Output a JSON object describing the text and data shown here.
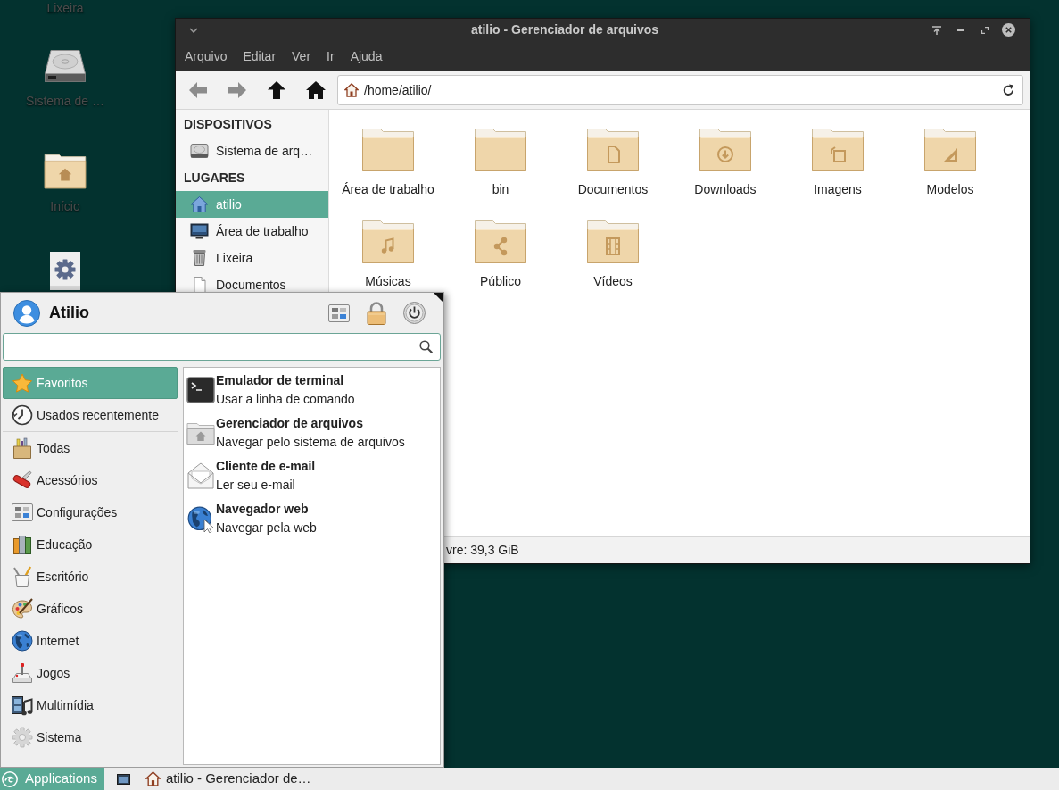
{
  "desktop": {
    "icons": [
      {
        "kind": "label",
        "label": "Lixeira"
      },
      {
        "kind": "drive",
        "label": "Sistema de …"
      },
      {
        "kind": "home",
        "label": "Início"
      },
      {
        "kind": "settings"
      }
    ]
  },
  "file_manager": {
    "title": "atilio - Gerenciador de arquivos",
    "menu": [
      "Arquivo",
      "Editar",
      "Ver",
      "Ir",
      "Ajuda"
    ],
    "toolbar": [
      {
        "kind": "back",
        "disabled": true
      },
      {
        "kind": "forward",
        "disabled": true
      },
      {
        "kind": "up",
        "disabled": false
      },
      {
        "kind": "home",
        "disabled": false
      }
    ],
    "address": "/home/atilio/",
    "sidebar": [
      {
        "heading": "DISPOSITIVOS",
        "items": [
          {
            "kind": "drive",
            "label": "Sistema de arq…",
            "selected": false
          }
        ]
      },
      {
        "heading": "LUGARES",
        "items": [
          {
            "kind": "home",
            "label": "atilio",
            "selected": true
          },
          {
            "kind": "desktop",
            "label": "Área de trabalho",
            "selected": false
          },
          {
            "kind": "trash",
            "label": "Lixeira",
            "selected": false
          },
          {
            "kind": "document",
            "label": "Documentos",
            "selected": false
          }
        ]
      }
    ],
    "files": [
      {
        "kind": "plain",
        "name": "Área de trabalho"
      },
      {
        "kind": "plain",
        "name": "bin"
      },
      {
        "kind": "document",
        "name": "Documentos"
      },
      {
        "kind": "download",
        "name": "Downloads"
      },
      {
        "kind": "image",
        "name": "Imagens"
      },
      {
        "kind": "template",
        "name": "Modelos"
      },
      {
        "kind": "music",
        "name": "Músicas"
      },
      {
        "kind": "share",
        "name": "Público"
      },
      {
        "kind": "video",
        "name": "Vídeos"
      }
    ],
    "status_bar": "vre: 39,3 GiB"
  },
  "menu": {
    "user": "Atilio",
    "category_groups": [
      {
        "items": [
          {
            "kind": "favorites",
            "label": "Favoritos",
            "selected": true
          },
          {
            "kind": "recent",
            "label": "Usados recentemente",
            "selected": false
          }
        ]
      },
      {
        "items": [
          {
            "kind": "all",
            "label": "Todas",
            "selected": false
          },
          {
            "kind": "accessories",
            "label": "Acessórios",
            "selected": false
          },
          {
            "kind": "settings",
            "label": "Configurações",
            "selected": false
          },
          {
            "kind": "education",
            "label": "Educação",
            "selected": false
          },
          {
            "kind": "office",
            "label": "Escritório",
            "selected": false
          },
          {
            "kind": "graphics",
            "label": "Gráficos",
            "selected": false
          },
          {
            "kind": "internet",
            "label": "Internet",
            "selected": false
          },
          {
            "kind": "games",
            "label": "Jogos",
            "selected": false
          },
          {
            "kind": "multimedia",
            "label": "Multimídia",
            "selected": false
          },
          {
            "kind": "system",
            "label": "Sistema",
            "selected": false
          }
        ]
      }
    ],
    "apps": [
      {
        "kind": "terminal",
        "name": "Emulador de terminal",
        "description": "Usar a linha de comando"
      },
      {
        "kind": "files",
        "name": "Gerenciador de arquivos",
        "description": "Navegar pelo sistema de arquivos"
      },
      {
        "kind": "email",
        "name": "Cliente de e-mail",
        "description": "Ler seu e-mail"
      },
      {
        "kind": "browser",
        "name": "Navegador web",
        "description": "Navegar pela web"
      }
    ]
  },
  "taskbar": {
    "start": {
      "label": "Applications",
      "active": true
    },
    "windows": [
      {
        "kind": "home",
        "title": "atilio - Gerenciador de…"
      }
    ]
  }
}
